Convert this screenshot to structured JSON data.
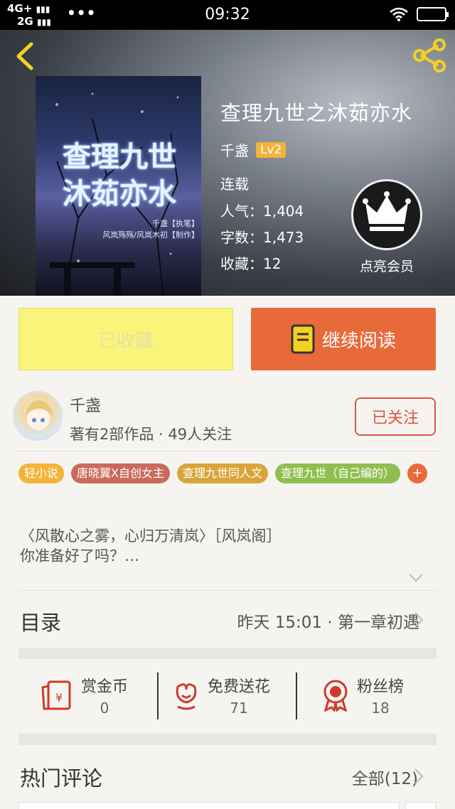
{
  "status_bar": {
    "network_top": "4G+",
    "network_bottom": "2G",
    "dots": "•••",
    "time": "09:32"
  },
  "book": {
    "title": "查理九世之沐茹亦水",
    "author": "千盏",
    "level": "Lv2",
    "status": "连载",
    "popularity": "人气：1,404",
    "word_count": "字数：1,473",
    "favorites": "收藏：12",
    "cover_title_line1": "查理九世",
    "cover_title_line2": "沐茹亦水",
    "cover_credit_line1": "千盏【执笔】",
    "cover_credit_line2": "风岚殇殇/风岚木初【制作】"
  },
  "vip": {
    "label": "点亮会员"
  },
  "actions": {
    "favorite_label": "已收藏",
    "read_label": "继续阅读"
  },
  "author_card": {
    "name": "千盏",
    "stats": "著有2部作品 · 49人关注",
    "follow_label": "已关注"
  },
  "tags": [
    {
      "label": "轻小说",
      "color": "#f2b43a"
    },
    {
      "label": "唐晓翼X自创女主",
      "color": "#c96a5a"
    },
    {
      "label": "查理九世同人文",
      "color": "#d9a53b"
    },
    {
      "label": "查理九世（自己编的）",
      "color": "#8fbf4e"
    }
  ],
  "tag_add": "+",
  "intro": {
    "line1": "〈风散心之雾，心归万清岚〉［风岚阁］",
    "line2": "你准备好了吗？…"
  },
  "toc": {
    "title": "目录",
    "latest": "昨天 15:01 · 第一章初遇"
  },
  "stats": {
    "reward": {
      "label": "赏金币",
      "value": "0",
      "icon": "red-envelope-icon"
    },
    "flower": {
      "label": "免费送花",
      "value": "71",
      "icon": "flower-icon"
    },
    "fans": {
      "label": "粉丝榜",
      "value": "18",
      "icon": "medal-icon"
    }
  },
  "comments": {
    "title": "热门评论",
    "all_label": "全部(12)"
  },
  "colors": {
    "accent": "#e8693a",
    "favorite_bg": "#fbf47a",
    "follow": "#d9573b",
    "icon_red": "#cf3a2a"
  }
}
